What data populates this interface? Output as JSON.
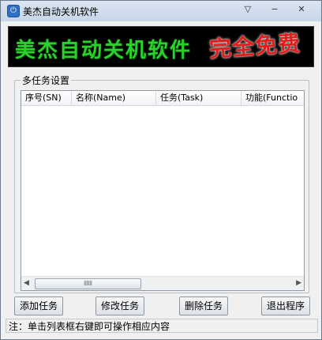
{
  "window": {
    "title": "美杰自动关机软件",
    "controls": {
      "menu": "▽",
      "minimize": "−",
      "close": "✕"
    }
  },
  "banner": {
    "left_text": "美杰自动关机软件",
    "right_text": "完全免费",
    "colors": {
      "background": "#000000",
      "left": "#29d12a",
      "right": "#e21b1b"
    }
  },
  "group": {
    "title": "多任务设置"
  },
  "table": {
    "columns": [
      "序号(SN)",
      "名称(Name)",
      "任务(Task)",
      "功能(Functio"
    ],
    "rows": []
  },
  "scrollbar": {
    "left_arrow": "◀",
    "right_arrow": "▶",
    "thumb_grip": "⦀⦀⦀"
  },
  "buttons": {
    "add": "添加任务",
    "edit": "修改任务",
    "delete": "删除任务",
    "exit": "退出程序"
  },
  "status": {
    "text": "注：单击列表框右键即可操作相应内容"
  }
}
